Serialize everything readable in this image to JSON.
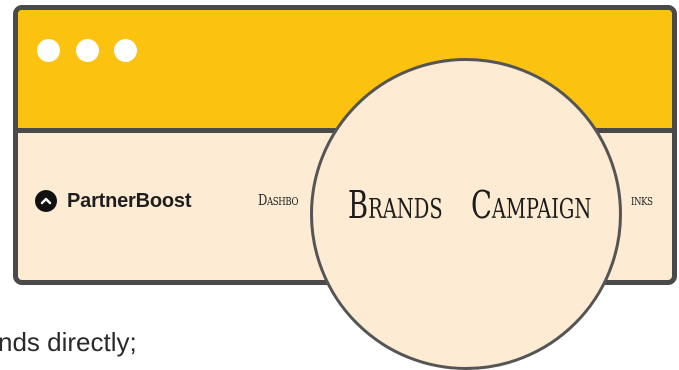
{
  "window": {
    "controls": [
      "close-dot",
      "minimize-dot",
      "maximize-dot"
    ],
    "titlebar_color": "#fbc30f",
    "content_bg": "#fdebd3",
    "border_color": "#4a4a4a"
  },
  "navbar": {
    "brand": "PartnerBoost",
    "brand_icon": "chevron-up-icon",
    "links": [
      "Dashbo",
      "inks"
    ]
  },
  "magnifier": {
    "items": [
      "Brands",
      "Campaign"
    ]
  },
  "caption": "nds directly;"
}
